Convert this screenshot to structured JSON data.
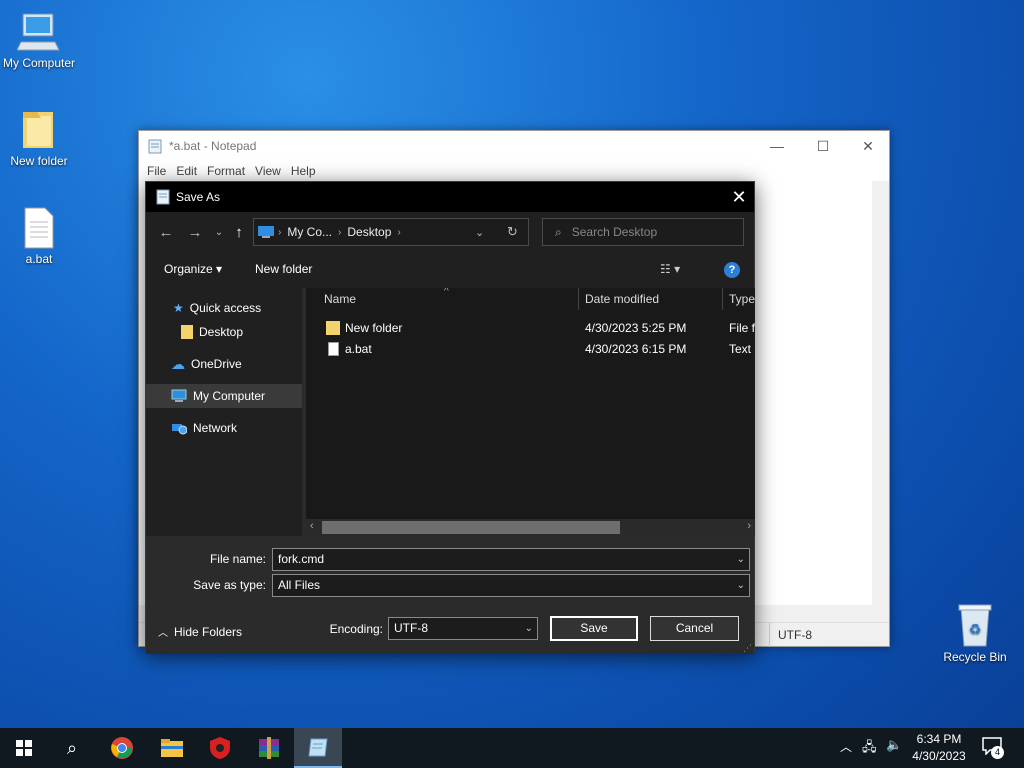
{
  "desktop": {
    "icons": [
      {
        "label": "My Computer"
      },
      {
        "label": "New folder"
      },
      {
        "label": "a.bat"
      },
      {
        "label": "Recycle Bin"
      }
    ]
  },
  "notepad": {
    "title": "*a.bat - Notepad",
    "menu": [
      "File",
      "Edit",
      "Format",
      "View",
      "Help"
    ],
    "status_encoding": "UTF-8",
    "controls": {
      "minimize": "—",
      "maximize": "☐",
      "close": "✕"
    }
  },
  "dialog": {
    "title": "Save As",
    "close": "✕",
    "address": {
      "crumbs": [
        "My Co...",
        "Desktop"
      ]
    },
    "search_placeholder": "Search Desktop",
    "toolbar": {
      "organize": "Organize ▾",
      "new_folder": "New folder"
    },
    "nav_items": [
      {
        "label": "Quick access"
      },
      {
        "label": "Desktop"
      },
      {
        "label": "OneDrive"
      },
      {
        "label": "My Computer"
      },
      {
        "label": "Network"
      }
    ],
    "columns": {
      "name": "Name",
      "date": "Date modified",
      "type": "Type"
    },
    "files": [
      {
        "name": "New folder",
        "date": "4/30/2023 5:25 PM",
        "type": "File fo"
      },
      {
        "name": "a.bat",
        "date": "4/30/2023 6:15 PM",
        "type": "Text D"
      }
    ],
    "file_name_label": "File name:",
    "file_name_value": "fork.cmd",
    "save_type_label": "Save as type:",
    "save_type_value": "All Files",
    "hide_folders": "Hide Folders",
    "encoding_label": "Encoding:",
    "encoding_value": "UTF-8",
    "save_label": "Save",
    "cancel_label": "Cancel"
  },
  "taskbar": {
    "clock_time": "6:34 PM",
    "clock_date": "4/30/2023",
    "notification_count": "4"
  },
  "colors": {
    "accent": "#0078d7",
    "desktop": "#1466c9",
    "dialog_bg": "#202020"
  }
}
